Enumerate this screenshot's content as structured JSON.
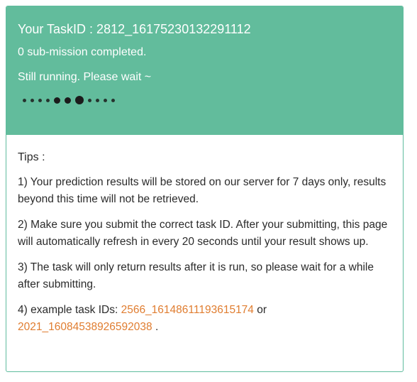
{
  "status": {
    "task_id_text": "Your TaskID : 2812_16175230132291112",
    "completed_text": "0 sub-mission completed.",
    "running_text": "Still running. Please wait ~"
  },
  "tips": {
    "title": "Tips :",
    "tip1": "1) Your prediction results will be stored on our server for 7 days only, results beyond this time will not be retrieved.",
    "tip2": "2) Make sure you submit the correct task ID. After your submitting, this page will automatically refresh in every 20 seconds until your result shows up.",
    "tip3": "3) The task will only return results after it is run, so please wait for a while after submitting.",
    "tip4_prefix": "4) example task IDs: ",
    "example_id_1": "2566_16148611193615174",
    "tip4_mid": " or",
    "example_id_2": "2021_16084538926592038",
    "tip4_suffix": " ."
  },
  "colors": {
    "header_bg": "#62bc9c",
    "link": "#e07d30"
  }
}
